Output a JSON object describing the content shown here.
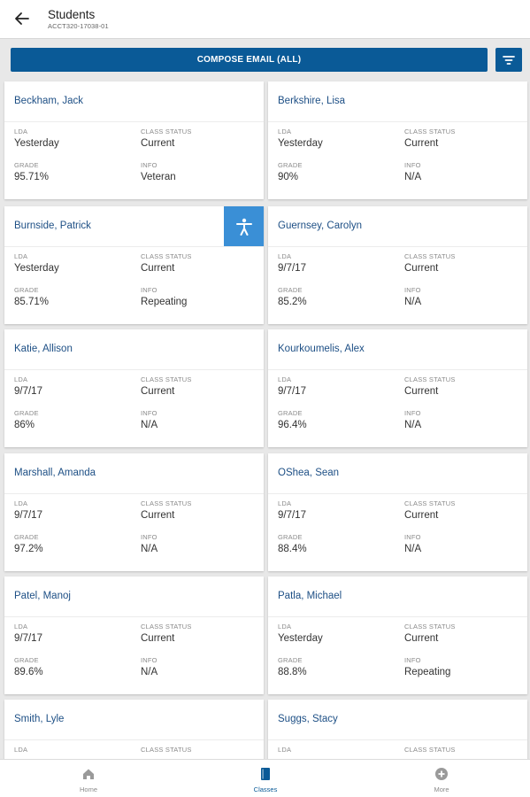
{
  "header": {
    "title": "Students",
    "subtitle": "ACCT320-17038-01"
  },
  "toolbar": {
    "compose_label": "COMPOSE EMAIL (ALL)"
  },
  "labels": {
    "lda": "LDA",
    "class_status": "CLASS STATUS",
    "grade": "GRADE",
    "info": "INFO"
  },
  "students": [
    {
      "name": "Beckham, Jack",
      "lda": "Yesterday",
      "status": "Current",
      "grade": "95.71%",
      "info": "Veteran"
    },
    {
      "name": "Berkshire, Lisa",
      "lda": "Yesterday",
      "status": "Current",
      "grade": "90%",
      "info": "N/A"
    },
    {
      "name": "Burnside, Patrick",
      "lda": "Yesterday",
      "status": "Current",
      "grade": "85.71%",
      "info": "Repeating"
    },
    {
      "name": "Guernsey, Carolyn",
      "lda": "9/7/17",
      "status": "Current",
      "grade": "85.2%",
      "info": "N/A"
    },
    {
      "name": "Katie, Allison",
      "lda": "9/7/17",
      "status": "Current",
      "grade": "86%",
      "info": "N/A"
    },
    {
      "name": "Kourkoumelis, Alex",
      "lda": "9/7/17",
      "status": "Current",
      "grade": "96.4%",
      "info": "N/A"
    },
    {
      "name": "Marshall, Amanda",
      "lda": "9/7/17",
      "status": "Current",
      "grade": "97.2%",
      "info": "N/A"
    },
    {
      "name": "OShea, Sean",
      "lda": "9/7/17",
      "status": "Current",
      "grade": "88.4%",
      "info": "N/A"
    },
    {
      "name": "Patel, Manoj",
      "lda": "9/7/17",
      "status": "Current",
      "grade": "89.6%",
      "info": "N/A"
    },
    {
      "name": "Patla, Michael",
      "lda": "Yesterday",
      "status": "Current",
      "grade": "88.8%",
      "info": "Repeating"
    },
    {
      "name": "Smith, Lyle",
      "lda": "",
      "status": "",
      "grade": "",
      "info": ""
    },
    {
      "name": "Suggs, Stacy",
      "lda": "",
      "status": "",
      "grade": "",
      "info": ""
    }
  ],
  "nav": [
    {
      "label": "Home",
      "icon": "home-icon"
    },
    {
      "label": "Classes",
      "icon": "book-icon"
    },
    {
      "label": "More",
      "icon": "plus-circle-icon"
    }
  ],
  "colors": {
    "primary": "#0a5a97",
    "accessibility": "#3a8fd6",
    "name_text": "#1d4f85"
  }
}
